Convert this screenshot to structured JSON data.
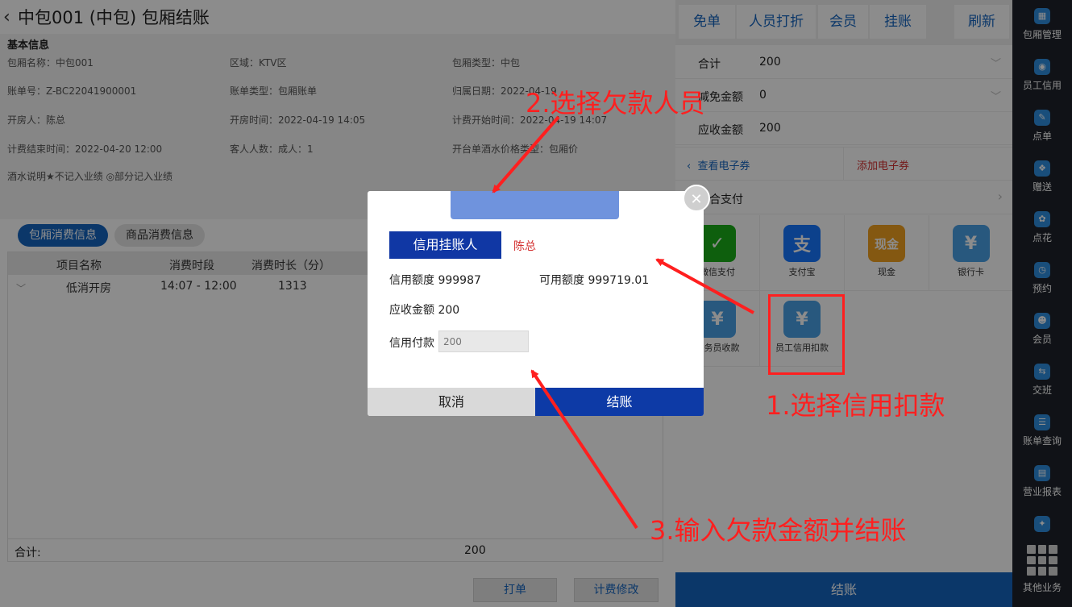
{
  "header": {
    "back_icon": "‹",
    "title": "中包001 (中包) 包厢结账"
  },
  "info": {
    "section_title": "基本信息",
    "room_name": "包厢名称：中包001",
    "area": "区域：KTV区",
    "room_type": "包厢类型：中包",
    "bill_no": "账单号：Z-BC22041900001",
    "bill_type": "账单类型：包厢账单",
    "belong_date": "归属日期：2022-04-19",
    "opener": "开房人：陈总",
    "open_time": "开房时间：2022-04-19 14:05",
    "bill_start": "计费开始时间：2022-04-19 14:07",
    "bill_end": "计费结束时间：2022-04-20 12:00",
    "guests": "客人人数：成人：1",
    "price_type": "开台单酒水价格类型：包厢价",
    "note": "酒水说明★不记入业绩 ◎部分记入业绩"
  },
  "tabs": [
    "包厢消费信息",
    "商品消费信息"
  ],
  "table": {
    "headers": [
      "项目名称",
      "消费时段",
      "消费时长（分）"
    ],
    "rows": [
      [
        "低消开房",
        "14:07 - 12:00",
        "1313"
      ]
    ],
    "total_label": "合计:",
    "total_value": "200"
  },
  "bottom_buttons": {
    "print": "打单",
    "modify": "计费修改"
  },
  "right": {
    "top_buttons": [
      "免单",
      "人员打折",
      "会员",
      "挂账",
      "刷新"
    ],
    "summary": [
      {
        "label": "合计",
        "value": "200"
      },
      {
        "label": "减免金额",
        "value": "0"
      },
      {
        "label": "应收金额",
        "value": "200"
      }
    ],
    "voucher_view": "查看电子券",
    "voucher_add": "添加电子券",
    "combo_label": "组合支付",
    "pay_methods": [
      {
        "label": "微信支付",
        "icon": "wechat-pay-icon",
        "glyph": "✓",
        "color": "#1aad19"
      },
      {
        "label": "支付宝",
        "icon": "alipay-icon",
        "glyph": "支",
        "color": "#1677ff"
      },
      {
        "label": "现金",
        "icon": "cash-icon",
        "glyph": "现金",
        "color": "#f0a020"
      },
      {
        "label": "银行卡",
        "icon": "bank-card-icon",
        "glyph": "¥",
        "color": "#4aa0e6"
      },
      {
        "label": "服务员收款",
        "icon": "waiter-collect-icon",
        "glyph": "¥",
        "color": "#4aa0e6"
      },
      {
        "label": "员工信用扣款",
        "icon": "staff-credit-icon",
        "glyph": "¥",
        "color": "#4aa0e6"
      }
    ],
    "settle": "结账"
  },
  "sidebar": {
    "items": [
      "包厢管理",
      "员工信用",
      "点单",
      "赠送",
      "点花",
      "预约",
      "会员",
      "交班",
      "账单查询",
      "营业报表"
    ],
    "more": "其他业务"
  },
  "modal": {
    "credit_person_btn": "信用挂账人",
    "credit_person_name": "陈总",
    "credit_limit_label": "信用额度",
    "credit_limit": "999987",
    "available_label": "可用额度",
    "available": "999719.01",
    "receivable_label": "应收金额",
    "receivable": "200",
    "credit_pay_label": "信用付款",
    "credit_pay_placeholder": "200",
    "cancel": "取消",
    "confirm": "结账"
  },
  "annotations": {
    "step1": "1.选择信用扣款",
    "step2": "2.选择欠款人员",
    "step3": "3.输入欠款金额并结账"
  },
  "colors": {
    "primary": "#1565c0",
    "modal_primary": "#0d3aa6",
    "annotation": "#ff1f1f",
    "sidebar_bg": "#1e222a"
  }
}
